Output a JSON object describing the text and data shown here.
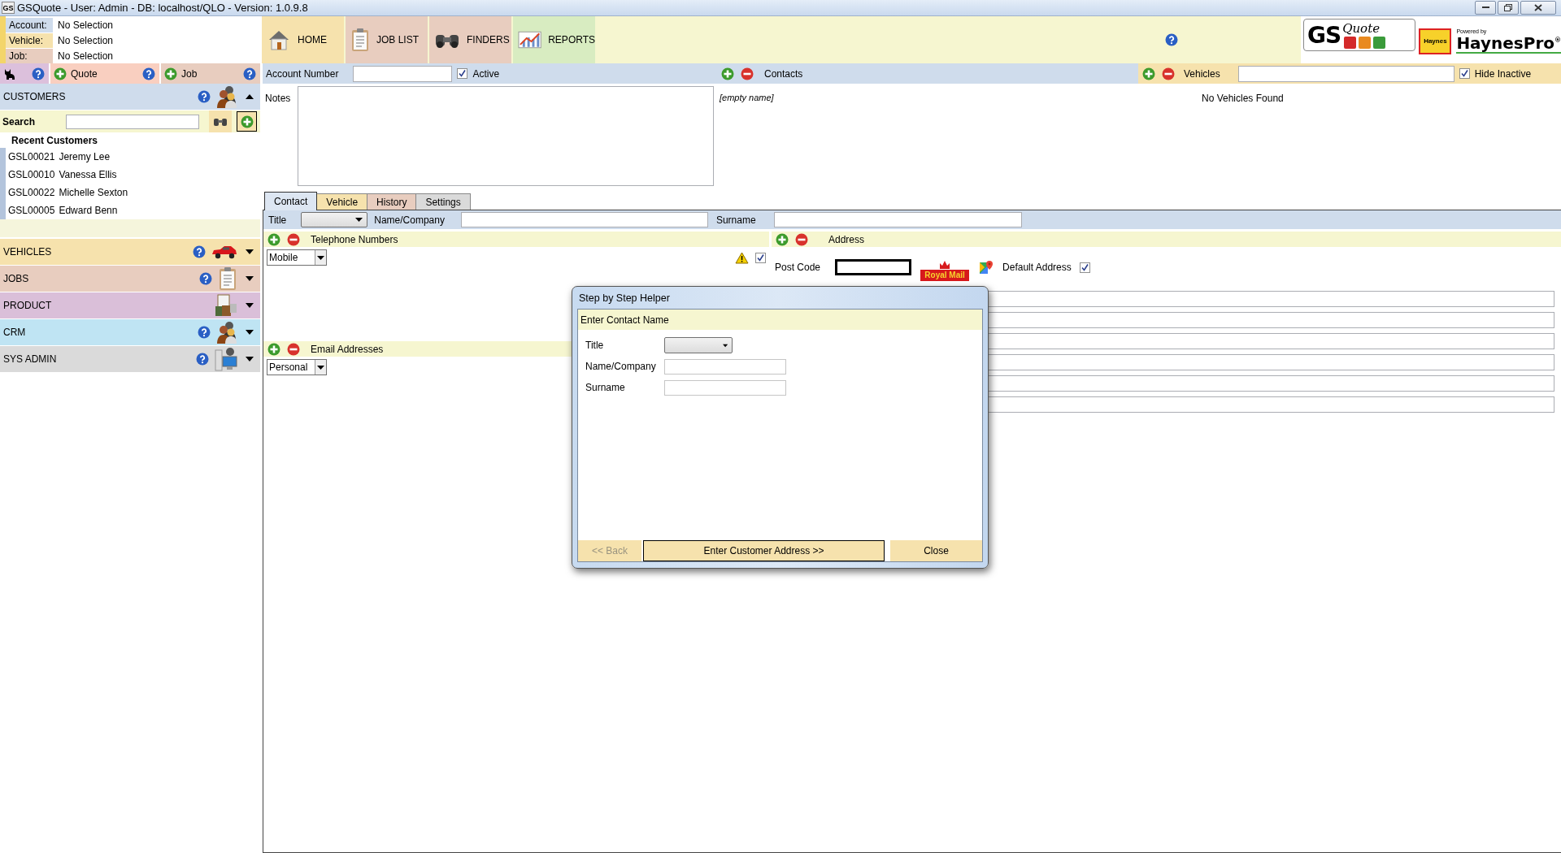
{
  "window": {
    "app_icon": "GS",
    "title": "GSQuote - User: Admin - DB: localhost/QLO - Version: 1.0.9.8"
  },
  "selection": [
    {
      "label": "Account:",
      "value": "No Selection"
    },
    {
      "label": "Vehicle:",
      "value": "No Selection"
    },
    {
      "label": "Job:",
      "value": "No Selection"
    }
  ],
  "nav": [
    {
      "label": "HOME"
    },
    {
      "label": "JOB LIST"
    },
    {
      "label": "FINDERS"
    },
    {
      "label": "REPORTS"
    }
  ],
  "logos": {
    "gs": "GS",
    "quote": "Quote",
    "haynes_badge": "Haynes",
    "powered_by": "Powered by",
    "haynespro": "HaynesPro$^{®}$"
  },
  "actions": [
    {
      "label": "Quote"
    },
    {
      "label": "Job"
    }
  ],
  "customers": {
    "title": "CUSTOMERS",
    "expanded": true,
    "search_label": "Search",
    "recent_title": "Recent Customers",
    "recent": [
      {
        "code": "GSL00021",
        "name": "Jeremy Lee"
      },
      {
        "code": "GSL00010",
        "name": "Vanessa Ellis"
      },
      {
        "code": "GSL00022",
        "name": "Michelle Sexton"
      },
      {
        "code": "GSL00005",
        "name": "Edward Benn"
      }
    ]
  },
  "sections": [
    {
      "title": "VEHICLES",
      "expanded": false,
      "help": true
    },
    {
      "title": "JOBS",
      "expanded": false,
      "help": true
    },
    {
      "title": "PRODUCT",
      "expanded": false,
      "help": false
    },
    {
      "title": "CRM",
      "expanded": false,
      "help": true
    },
    {
      "title": "SYS ADMIN",
      "expanded": false,
      "help": true
    }
  ],
  "account": {
    "label": "Account Number",
    "active_label": "Active",
    "active": true,
    "notes_label": "Notes"
  },
  "contacts": {
    "title": "Contacts",
    "items": [
      "[empty name]"
    ]
  },
  "vehicles": {
    "title": "Vehicles",
    "hide_inactive_label": "Hide Inactive",
    "hide_inactive": true,
    "empty_text": "No Vehicles Found"
  },
  "tabs": [
    {
      "label": "Contact",
      "selected": true
    },
    {
      "label": "Vehicle",
      "selected": false
    },
    {
      "label": "History",
      "selected": false
    },
    {
      "label": "Settings",
      "selected": false
    }
  ],
  "contact_form": {
    "title_label": "Title",
    "name_label": "Name/Company",
    "surname_label": "Surname"
  },
  "telephone": {
    "title": "Telephone Numbers",
    "type": "Mobile",
    "verified": true
  },
  "email": {
    "title": "Email Addresses",
    "type": "Personal"
  },
  "address": {
    "title": "Address",
    "postcode_label": "Post Code",
    "royal_mail": "Royal Mail",
    "default_label": "Default Address",
    "default": true
  },
  "dialog": {
    "title": "Step by Step Helper",
    "step": "Enter Contact Name",
    "fields": [
      {
        "label": "Title",
        "kind": "select"
      },
      {
        "label": "Name/Company",
        "kind": "text"
      },
      {
        "label": "Surname",
        "kind": "text"
      }
    ],
    "buttons": [
      {
        "label": "<< Back",
        "disabled": true,
        "focused": false
      },
      {
        "label": "Enter Customer Address >>",
        "disabled": false,
        "focused": true
      },
      {
        "label": "Close",
        "disabled": false,
        "focused": false
      }
    ]
  }
}
